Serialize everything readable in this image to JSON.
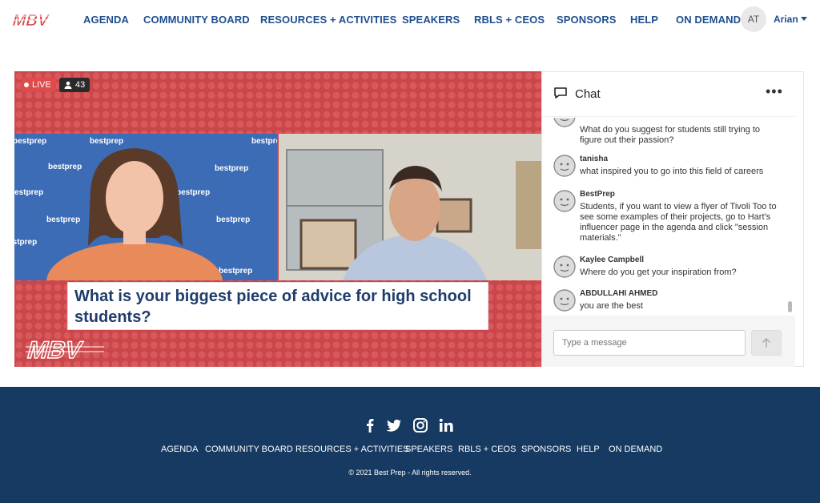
{
  "brand": {
    "logo_alt": "MBV",
    "accent": "#c9464a",
    "navy": "#163a62",
    "link_blue": "#1f4f8f"
  },
  "nav": {
    "items": [
      "AGENDA",
      "COMMUNITY BOARD",
      "RESOURCES + ACTIVITIES",
      "SPEAKERS",
      "RBLS + CEOS",
      "SPONSORS",
      "HELP",
      "ON DEMAND"
    ],
    "user_initials": "AT",
    "user_name": "Arian"
  },
  "video": {
    "live_label": "LIVE",
    "viewer_count": "43",
    "question": "What is your biggest piece of advice for high school students?",
    "watermark": "bestprep"
  },
  "chat": {
    "title": "Chat",
    "more_label": "•••",
    "messages": [
      {
        "author": "",
        "text": "What do you suggest for students still trying to figure out their passion?"
      },
      {
        "author": "tanisha",
        "text": "what inspired you to go into this field of careers"
      },
      {
        "author": "BestPrep",
        "text": "Students, if you want to view a flyer of Tivoli Too to see some examples of their projects, go to Hart's influencer page in the agenda and click \"session materials.\""
      },
      {
        "author": "Kaylee Campbell",
        "text": "Where do you get your inspiration from?"
      },
      {
        "author": "ABDULLAHI AHMED",
        "text": "you are the best"
      }
    ],
    "input_placeholder": "Type a message"
  },
  "footer": {
    "social_icons": [
      "facebook-icon",
      "twitter-icon",
      "instagram-icon",
      "linkedin-icon"
    ],
    "links": [
      "AGENDA",
      "COMMUNITY BOARD",
      "RESOURCES + ACTIVITIES",
      "SPEAKERS",
      "RBLS + CEOS",
      "SPONSORS",
      "HELP",
      "ON DEMAND"
    ],
    "copyright": "© 2021 Best Prep - All rights reserved."
  }
}
